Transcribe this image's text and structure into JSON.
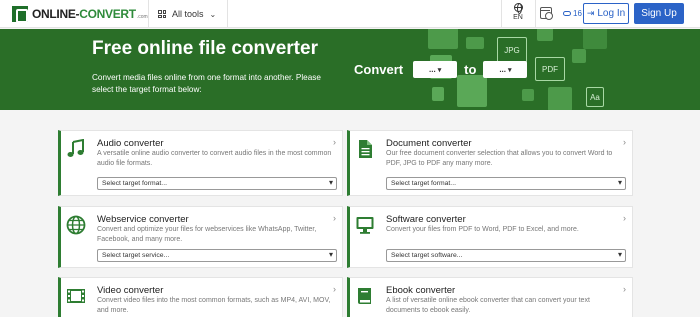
{
  "header": {
    "logo_text_a": "ONLINE-",
    "logo_text_b": "CONVERT",
    "logo_tld": ".com",
    "all_tools": "All tools",
    "language": "EN",
    "credits": "16",
    "login_label": "Log In",
    "signup_label": "Sign Up"
  },
  "hero": {
    "title": "Free online file converter",
    "subtitle": "Convert media files online from one format into another. Please select the target format below:",
    "convert_label": "Convert",
    "from_value": "...",
    "to_label": "to",
    "to_value": "...",
    "deco_labels": [
      "JPG",
      "PDF",
      "Aa"
    ]
  },
  "cards": [
    {
      "title": "Audio converter",
      "desc": "A versatile online audio converter to convert audio files in the most common audio file formats.",
      "select": "Select target format...",
      "icon": "music-note-icon"
    },
    {
      "title": "Document converter",
      "desc": "Our free document converter selection that allows you to convert Word to PDF, JPG to PDF any many more.",
      "select": "Select target format...",
      "icon": "document-icon"
    },
    {
      "title": "Webservice converter",
      "desc": "Convert and optimize your files for webservices like WhatsApp, Twitter, Facebook, and many more.",
      "select": "Select target service...",
      "icon": "globe-icon"
    },
    {
      "title": "Software converter",
      "desc": "Convert your files from PDF to Word, PDF to Excel, and more.",
      "select": "Select target software...",
      "icon": "monitor-icon"
    },
    {
      "title": "Video converter",
      "desc": "Convert video files into the most common formats, such as MP4, AVI, MOV, and more.",
      "select": "",
      "icon": "film-icon"
    },
    {
      "title": "Ebook converter",
      "desc": "A list of versatile online ebook converter that can convert your text documents to ebook easily.",
      "select": "",
      "icon": "book-icon"
    }
  ],
  "colors": {
    "brand_green": "#2a6e27",
    "accent_blue": "#2b63c7"
  }
}
